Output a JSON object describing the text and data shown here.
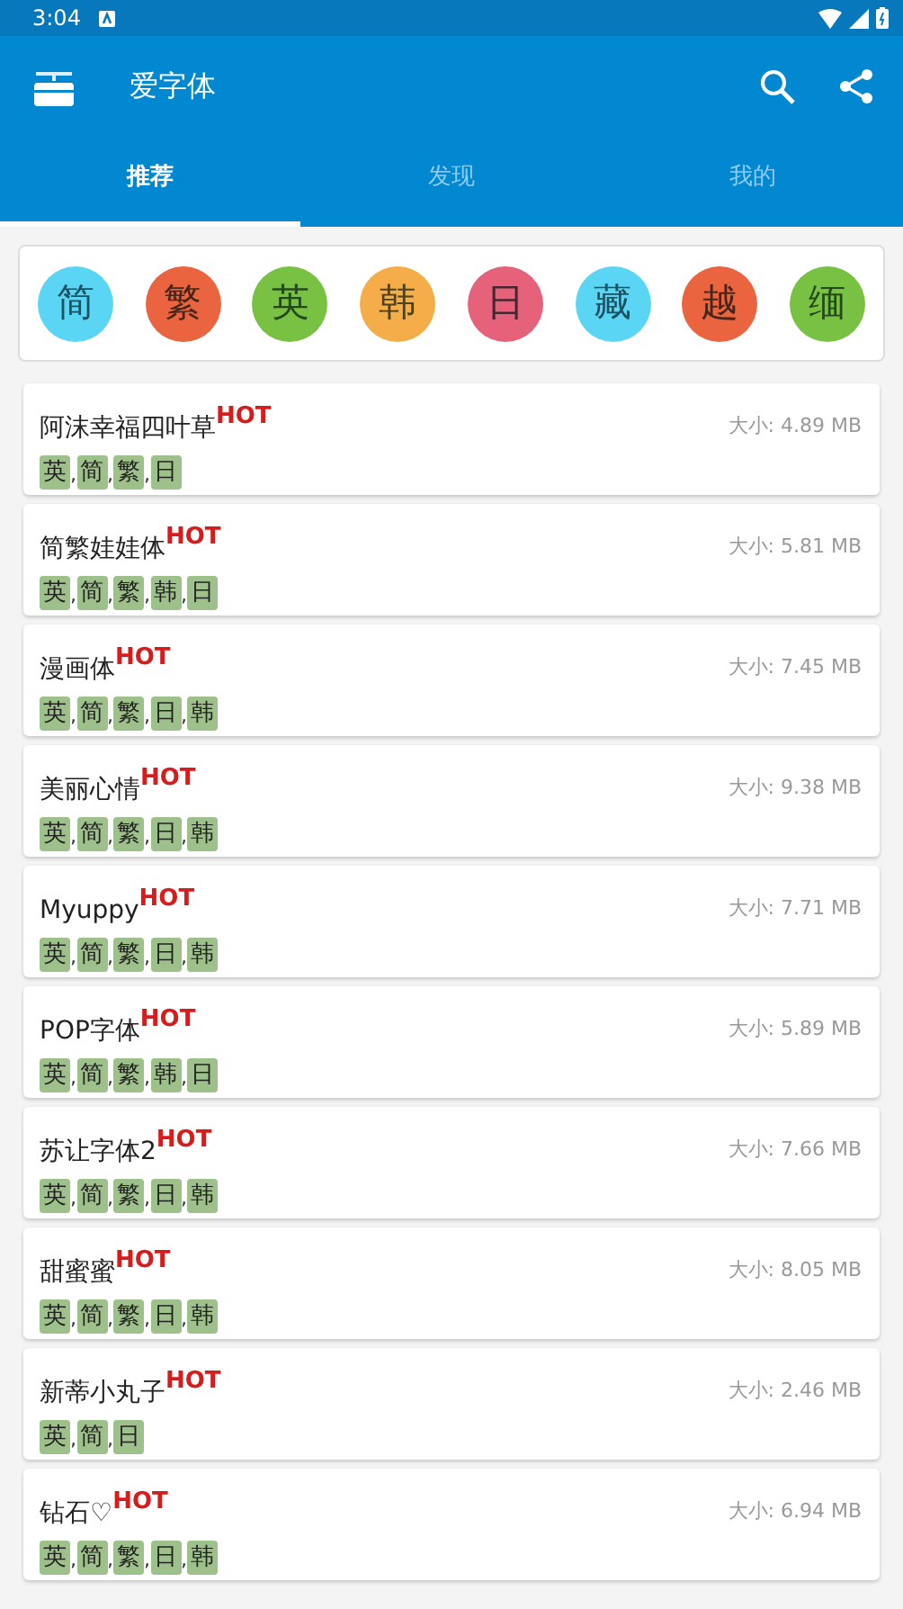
{
  "status_bar": {
    "time": "3:04"
  },
  "app_bar": {
    "title": "爱字体"
  },
  "tabs": [
    {
      "label": "推荐",
      "selected": true
    },
    {
      "label": "发现",
      "selected": false
    },
    {
      "label": "我的",
      "selected": false
    }
  ],
  "languages": [
    {
      "label": "简",
      "color": "#5ad5f3"
    },
    {
      "label": "繁",
      "color": "#ea6440"
    },
    {
      "label": "英",
      "color": "#79c143"
    },
    {
      "label": "韩",
      "color": "#f4ad48"
    },
    {
      "label": "日",
      "color": "#e6617a"
    },
    {
      "label": "藏",
      "color": "#5ad5f3"
    },
    {
      "label": "越",
      "color": "#ea6440"
    },
    {
      "label": "缅",
      "color": "#79c143"
    }
  ],
  "fonts": [
    {
      "name": "阿沫幸福四叶草",
      "badge": "HOT",
      "size": "大小: 4.89 MB",
      "tags": [
        {
          "label": "英",
          "sep": ","
        },
        {
          "label": "简",
          "sep": ","
        },
        {
          "label": "繁",
          "sep": ","
        },
        {
          "label": "日"
        }
      ]
    },
    {
      "name": "简繁娃娃体",
      "badge": "HOT",
      "size": "大小: 5.81 MB",
      "tags": [
        {
          "label": "英",
          "sep": ","
        },
        {
          "label": "简",
          "sep": ","
        },
        {
          "label": "繁",
          "sep": ","
        },
        {
          "label": "韩",
          "sep": ","
        },
        {
          "label": "日"
        }
      ]
    },
    {
      "name": "漫画体",
      "badge": "HOT",
      "size": "大小: 7.45 MB",
      "tags": [
        {
          "label": "英",
          "sep": ","
        },
        {
          "label": "简",
          "sep": ","
        },
        {
          "label": "繁",
          "sep": ","
        },
        {
          "label": "日",
          "sep": ","
        },
        {
          "label": "韩"
        }
      ]
    },
    {
      "name": "美丽心情",
      "badge": "HOT",
      "size": "大小: 9.38 MB",
      "tags": [
        {
          "label": "英",
          "sep": ","
        },
        {
          "label": "简",
          "sep": ","
        },
        {
          "label": "繁",
          "sep": ","
        },
        {
          "label": "日",
          "sep": ","
        },
        {
          "label": "韩"
        }
      ]
    },
    {
      "name": "Myuppy",
      "badge": "HOT",
      "size": "大小: 7.71 MB",
      "tags": [
        {
          "label": "英",
          "sep": ","
        },
        {
          "label": "简",
          "sep": ","
        },
        {
          "label": "繁",
          "sep": ","
        },
        {
          "label": "日",
          "sep": ","
        },
        {
          "label": "韩"
        }
      ]
    },
    {
      "name": "POP字体",
      "badge": "HOT",
      "size": "大小: 5.89 MB",
      "tags": [
        {
          "label": "英",
          "sep": ","
        },
        {
          "label": "简",
          "sep": ","
        },
        {
          "label": "繁",
          "sep": ","
        },
        {
          "label": "韩",
          "sep": ","
        },
        {
          "label": "日"
        }
      ]
    },
    {
      "name": "苏让字体2",
      "badge": "HOT",
      "size": "大小: 7.66 MB",
      "tags": [
        {
          "label": "英",
          "sep": ","
        },
        {
          "label": "简",
          "sep": ","
        },
        {
          "label": "繁",
          "sep": ","
        },
        {
          "label": "日",
          "sep": ","
        },
        {
          "label": "韩"
        }
      ]
    },
    {
      "name": "甜蜜蜜",
      "badge": "HOT",
      "size": "大小: 8.05 MB",
      "tags": [
        {
          "label": "英",
          "sep": ","
        },
        {
          "label": "简",
          "sep": ","
        },
        {
          "label": "繁",
          "sep": ","
        },
        {
          "label": "日",
          "sep": ","
        },
        {
          "label": "韩"
        }
      ]
    },
    {
      "name": "新蒂小丸子",
      "badge": "HOT",
      "size": "大小: 2.46 MB",
      "tags": [
        {
          "label": "英",
          "sep": ","
        },
        {
          "label": "简",
          "sep": ","
        },
        {
          "label": "日"
        }
      ]
    },
    {
      "name": "钻石♡",
      "badge": "HOT",
      "size": "大小: 6.94 MB",
      "tags": [
        {
          "label": "英",
          "sep": ","
        },
        {
          "label": "简",
          "sep": ","
        },
        {
          "label": "繁",
          "sep": ","
        },
        {
          "label": "日",
          "sep": ","
        },
        {
          "label": "韩"
        }
      ]
    }
  ]
}
